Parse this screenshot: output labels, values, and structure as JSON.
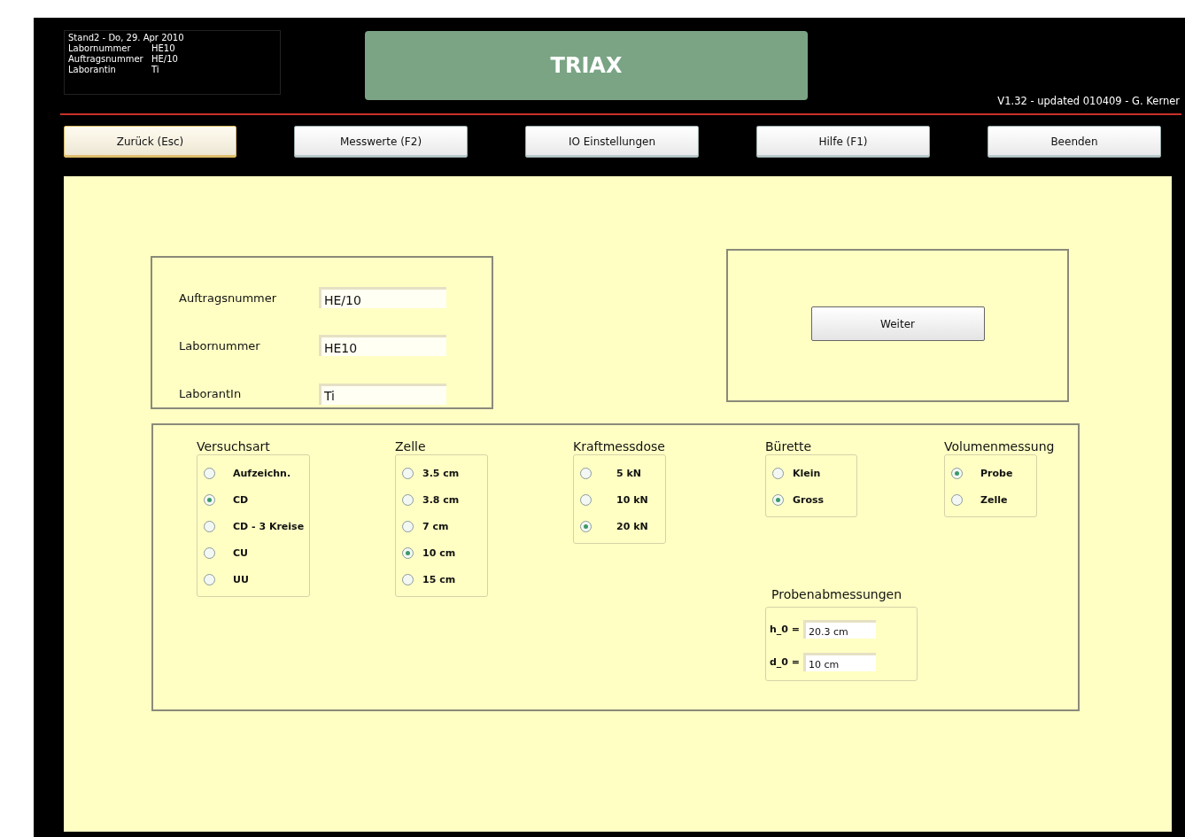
{
  "header": {
    "info_lines": [
      {
        "label": "Stand2  -  Do, 29. Apr 2010"
      },
      {
        "label": "Labornummer",
        "value": "HE10"
      },
      {
        "label": "Auftragsnummer",
        "value": "HE/10"
      },
      {
        "label": "Laborantin",
        "value": "Ti"
      }
    ],
    "title": "TRIAX",
    "version": "V1.32 - updated 010409 - G. Kerner"
  },
  "nav_buttons": [
    {
      "label": "Zurück (Esc)",
      "selected": true
    },
    {
      "label": "Messwerte (F2)",
      "selected": false
    },
    {
      "label": "IO Einstellungen",
      "selected": false
    },
    {
      "label": "Hilfe (F1)",
      "selected": false
    },
    {
      "label": "Beenden",
      "selected": false
    }
  ],
  "order_fields": [
    {
      "label": "Auftragsnummer",
      "value": "HE/10"
    },
    {
      "label": "Labornummer",
      "value": "HE10"
    },
    {
      "label": "LaborantIn",
      "value": "Ti"
    }
  ],
  "next_button": "Weiter",
  "option_groups": [
    {
      "title": "Versuchsart",
      "options": [
        {
          "label": "Aufzeichn.",
          "selected": false
        },
        {
          "label": "CD",
          "selected": true
        },
        {
          "label": "CD - 3 Kreise",
          "selected": false
        },
        {
          "label": "CU",
          "selected": false
        },
        {
          "label": "UU",
          "selected": false
        }
      ]
    },
    {
      "title": "Zelle",
      "options": [
        {
          "label": "3.5 cm",
          "selected": false
        },
        {
          "label": "3.8 cm",
          "selected": false
        },
        {
          "label": "7 cm",
          "selected": false
        },
        {
          "label": "10 cm",
          "selected": true
        },
        {
          "label": "15 cm",
          "selected": false
        }
      ]
    },
    {
      "title": "Kraftmessdose",
      "options": [
        {
          "label": "5 kN",
          "selected": false
        },
        {
          "label": "10 kN",
          "selected": false
        },
        {
          "label": "20 kN",
          "selected": true
        }
      ]
    },
    {
      "title": "Bürette",
      "options": [
        {
          "label": "Klein",
          "selected": false
        },
        {
          "label": "Gross",
          "selected": true
        }
      ]
    },
    {
      "title": "Volumenmessung",
      "options": [
        {
          "label": "Probe",
          "selected": true
        },
        {
          "label": "Zelle",
          "selected": false
        }
      ]
    }
  ],
  "dimensions": {
    "title": "Probenabmessungen",
    "fields": [
      {
        "label": "h_0 =",
        "value": "20.3 cm"
      },
      {
        "label": "d_0 =",
        "value": "10 cm"
      }
    ]
  }
}
